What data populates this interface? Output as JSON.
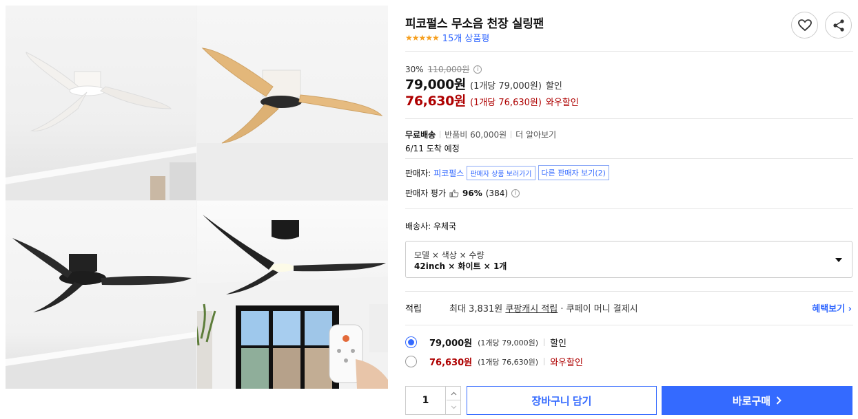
{
  "product": {
    "title": "피코펄스 무소음 천장 실링팬",
    "rating_stars": "★★★★★",
    "review_count": "15개 상품평"
  },
  "colors": {
    "accent": "#346aff",
    "wow_red": "#ae0000",
    "star": "#f6a021"
  },
  "price": {
    "discount_rate": "30%",
    "original": "110,000원",
    "sale": "79,000원",
    "sale_unit": "(1개당 79,000원)",
    "sale_label": "할인",
    "wow": "76,630원",
    "wow_unit": "(1개당 76,630원)",
    "wow_label": "와우할인"
  },
  "shipping": {
    "free": "무료배송",
    "return_fee": "반품비 60,000원",
    "more": "더 알아보기",
    "arrival": "6/11 도착 예정"
  },
  "seller": {
    "label": "판매자:",
    "name": "피코펄스",
    "view_products": "판매자 상품 보러가기",
    "other_sellers": "다른 판매자 보기(2)",
    "rating_label": "판매자 평가",
    "rating_pct": "96%",
    "rating_count": "(384)"
  },
  "carrier": "배송사: 우체국",
  "option": {
    "label": "모델 × 색상 × 수량",
    "value": "42inch × 화이트 × 1개"
  },
  "reward": {
    "label": "적립",
    "prefix": "최대 3,831원 ",
    "cash": "쿠팡캐시 적립",
    "suffix": " · 쿠페이 머니 결제시",
    "benefit": "혜택보기 ›"
  },
  "choices": [
    {
      "price": "79,000원",
      "unit": "(1개당 79,000원)",
      "label": "할인",
      "selected": true
    },
    {
      "price": "76,630원",
      "unit": "(1개당 76,630원)",
      "label": "와우할인",
      "selected": false
    }
  ],
  "actions": {
    "quantity": "1",
    "cart": "장바구니 담기",
    "buy": "바로구매"
  }
}
